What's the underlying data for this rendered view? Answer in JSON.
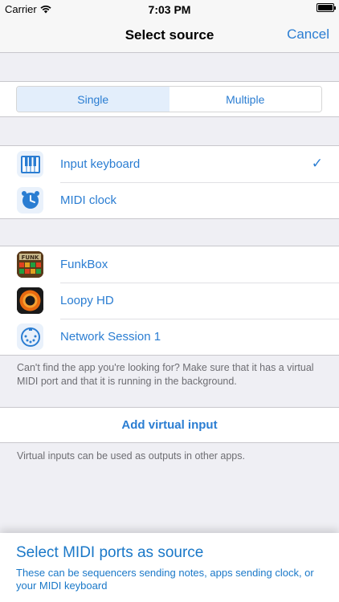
{
  "status_bar": {
    "carrier": "Carrier",
    "time": "7:03 PM"
  },
  "nav": {
    "title": "Select source",
    "cancel_label": "Cancel"
  },
  "segmented": {
    "single_label": "Single",
    "multiple_label": "Multiple",
    "selected": "Single"
  },
  "built_in": [
    {
      "label": "Input keyboard",
      "icon": "piano-keyboard-icon",
      "checked": true
    },
    {
      "label": "MIDI clock",
      "icon": "clock-icon",
      "checked": false
    }
  ],
  "apps": [
    {
      "label": "FunkBox",
      "icon": "funkbox-app-icon"
    },
    {
      "label": "Loopy HD",
      "icon": "loopy-hd-app-icon"
    },
    {
      "label": "Network Session 1",
      "icon": "midi-din-connector-icon"
    }
  ],
  "apps_note": "Can't find the app you're looking for? Make sure that it has a virtual MIDI port and that it is running in the background.",
  "add_virtual_input_label": "Add virtual input",
  "virtual_note": "Virtual inputs can be used as outputs in other apps.",
  "promo": {
    "title": "Select MIDI ports as source",
    "subtitle": "These can be sequencers sending notes, apps sending clock, or your MIDI keyboard"
  },
  "colors": {
    "accent": "#2a7dd2",
    "background": "#efeff4",
    "promo_text": "#1a78c8"
  },
  "checkmark": "✓",
  "funk_text": "FUNK"
}
